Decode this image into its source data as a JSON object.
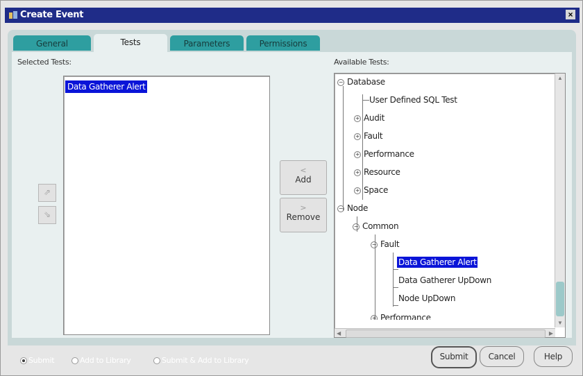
{
  "window": {
    "title": "Create Event",
    "close_label": "×"
  },
  "tabs": [
    "General",
    "Tests",
    "Parameters",
    "Permissions"
  ],
  "active_tab": "Tests",
  "selected_tests": {
    "label": "Selected Tests:",
    "items": [
      "Data Gatherer Alert"
    ],
    "move_up_icon": "up-arrow-icon",
    "move_down_icon": "down-arrow-icon"
  },
  "mid_buttons": {
    "add_label": "Add",
    "add_arrow": "<",
    "remove_label": "Remove",
    "remove_arrow": ">"
  },
  "available_tests": {
    "label": "Available Tests:",
    "tree": {
      "database": "Database",
      "user_defined_sql": "User Defined SQL Test",
      "audit": "Audit",
      "fault": "Fault",
      "performance": "Performance",
      "resource": "Resource",
      "space": "Space",
      "node": "Node",
      "common": "Common",
      "node_fault": "Fault",
      "data_gatherer_alert": "Data Gatherer Alert",
      "data_gatherer_updown": "Data Gatherer UpDown",
      "node_updown": "Node UpDown",
      "node_performance": "Performance"
    }
  },
  "footer": {
    "radios": [
      "Submit",
      "Add to Library",
      "Submit & Add to Library"
    ],
    "selected_radio": "Submit",
    "buttons": {
      "submit": "Submit",
      "cancel": "Cancel",
      "help": "Help"
    }
  },
  "colors": {
    "title_bar": "#1f2c88",
    "selection": "#0a14d8",
    "tab": "#2e9ea0",
    "frame": "#c9d8d8"
  }
}
